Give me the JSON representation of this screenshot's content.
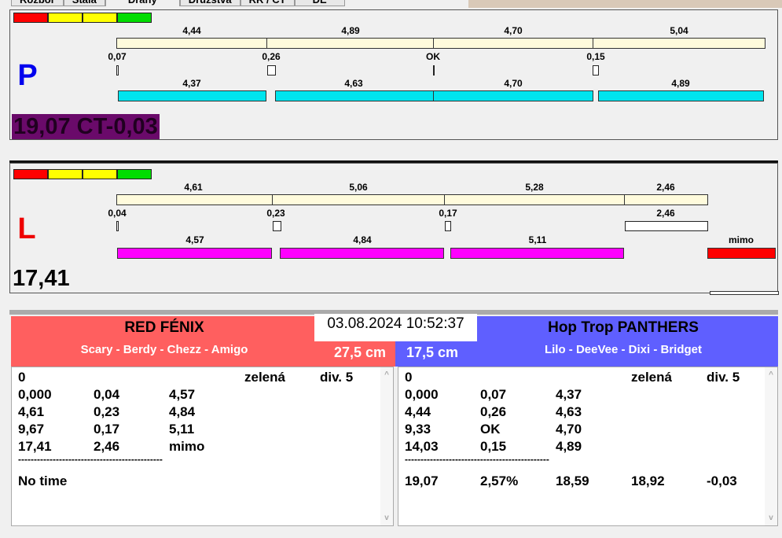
{
  "tabs": [
    "Rozbor",
    "Stála",
    "Dráhy",
    "Družstva",
    "RR / CT",
    "DE"
  ],
  "colors": {
    "red": "#ff0000",
    "yellow": "#ffff00",
    "green": "#00d000",
    "cyan": "#00e5ee",
    "magenta": "#ff00ff",
    "left_team": "#ff5f5f",
    "right_team": "#5f5fff",
    "purple": "#6a0a6a"
  },
  "p": {
    "letter": "P",
    "top_labels": [
      "4,44",
      "4,89",
      "4,70",
      "5,04"
    ],
    "mid_labels": [
      "0,07",
      "0,26",
      "OK",
      "0,15"
    ],
    "bottom_labels": [
      "4,37",
      "4,63",
      "4,70",
      "4,89"
    ],
    "result": "19,07 CT-0,03"
  },
  "l": {
    "letter": "L",
    "top_labels": [
      "4,61",
      "5,06",
      "5,28",
      "2,46"
    ],
    "mid_labels": [
      "0,04",
      "0,23",
      "0,17",
      "2,46"
    ],
    "bottom_labels": [
      "4,57",
      "4,84",
      "5,11",
      "mimo"
    ],
    "result": "17,41"
  },
  "datetime": "03.08.2024 10:52:37",
  "left_team": {
    "name": "RED FÉNIX",
    "members": "Scary - Berdy - Chezz - Amigo",
    "height": "27,5 cm",
    "header": [
      "0",
      "zelená",
      "div. 5"
    ],
    "rows": [
      [
        "0,000",
        "0,04",
        "4,57"
      ],
      [
        "4,61",
        "0,23",
        "4,84"
      ],
      [
        "9,67",
        "0,17",
        "5,11"
      ],
      [
        "17,41",
        "2,46",
        "mimo"
      ]
    ],
    "divider": "----------------------------------------------",
    "footer": "No time"
  },
  "right_team": {
    "name": "Hop Trop PANTHERS",
    "members": "Lilo - DeeVee - Dixi - Bridget",
    "height": "17,5 cm",
    "header": [
      "0",
      "zelená",
      "div. 5"
    ],
    "rows": [
      [
        "0,000",
        "0,07",
        "4,37"
      ],
      [
        "4,44",
        "0,26",
        "4,63"
      ],
      [
        "9,33",
        "OK",
        "4,70"
      ],
      [
        "14,03",
        "0,15",
        "4,89"
      ]
    ],
    "divider": "----------------------------------------------",
    "footer": [
      "19,07",
      "2,57%",
      "18,59",
      "18,92",
      "-0,03"
    ]
  }
}
